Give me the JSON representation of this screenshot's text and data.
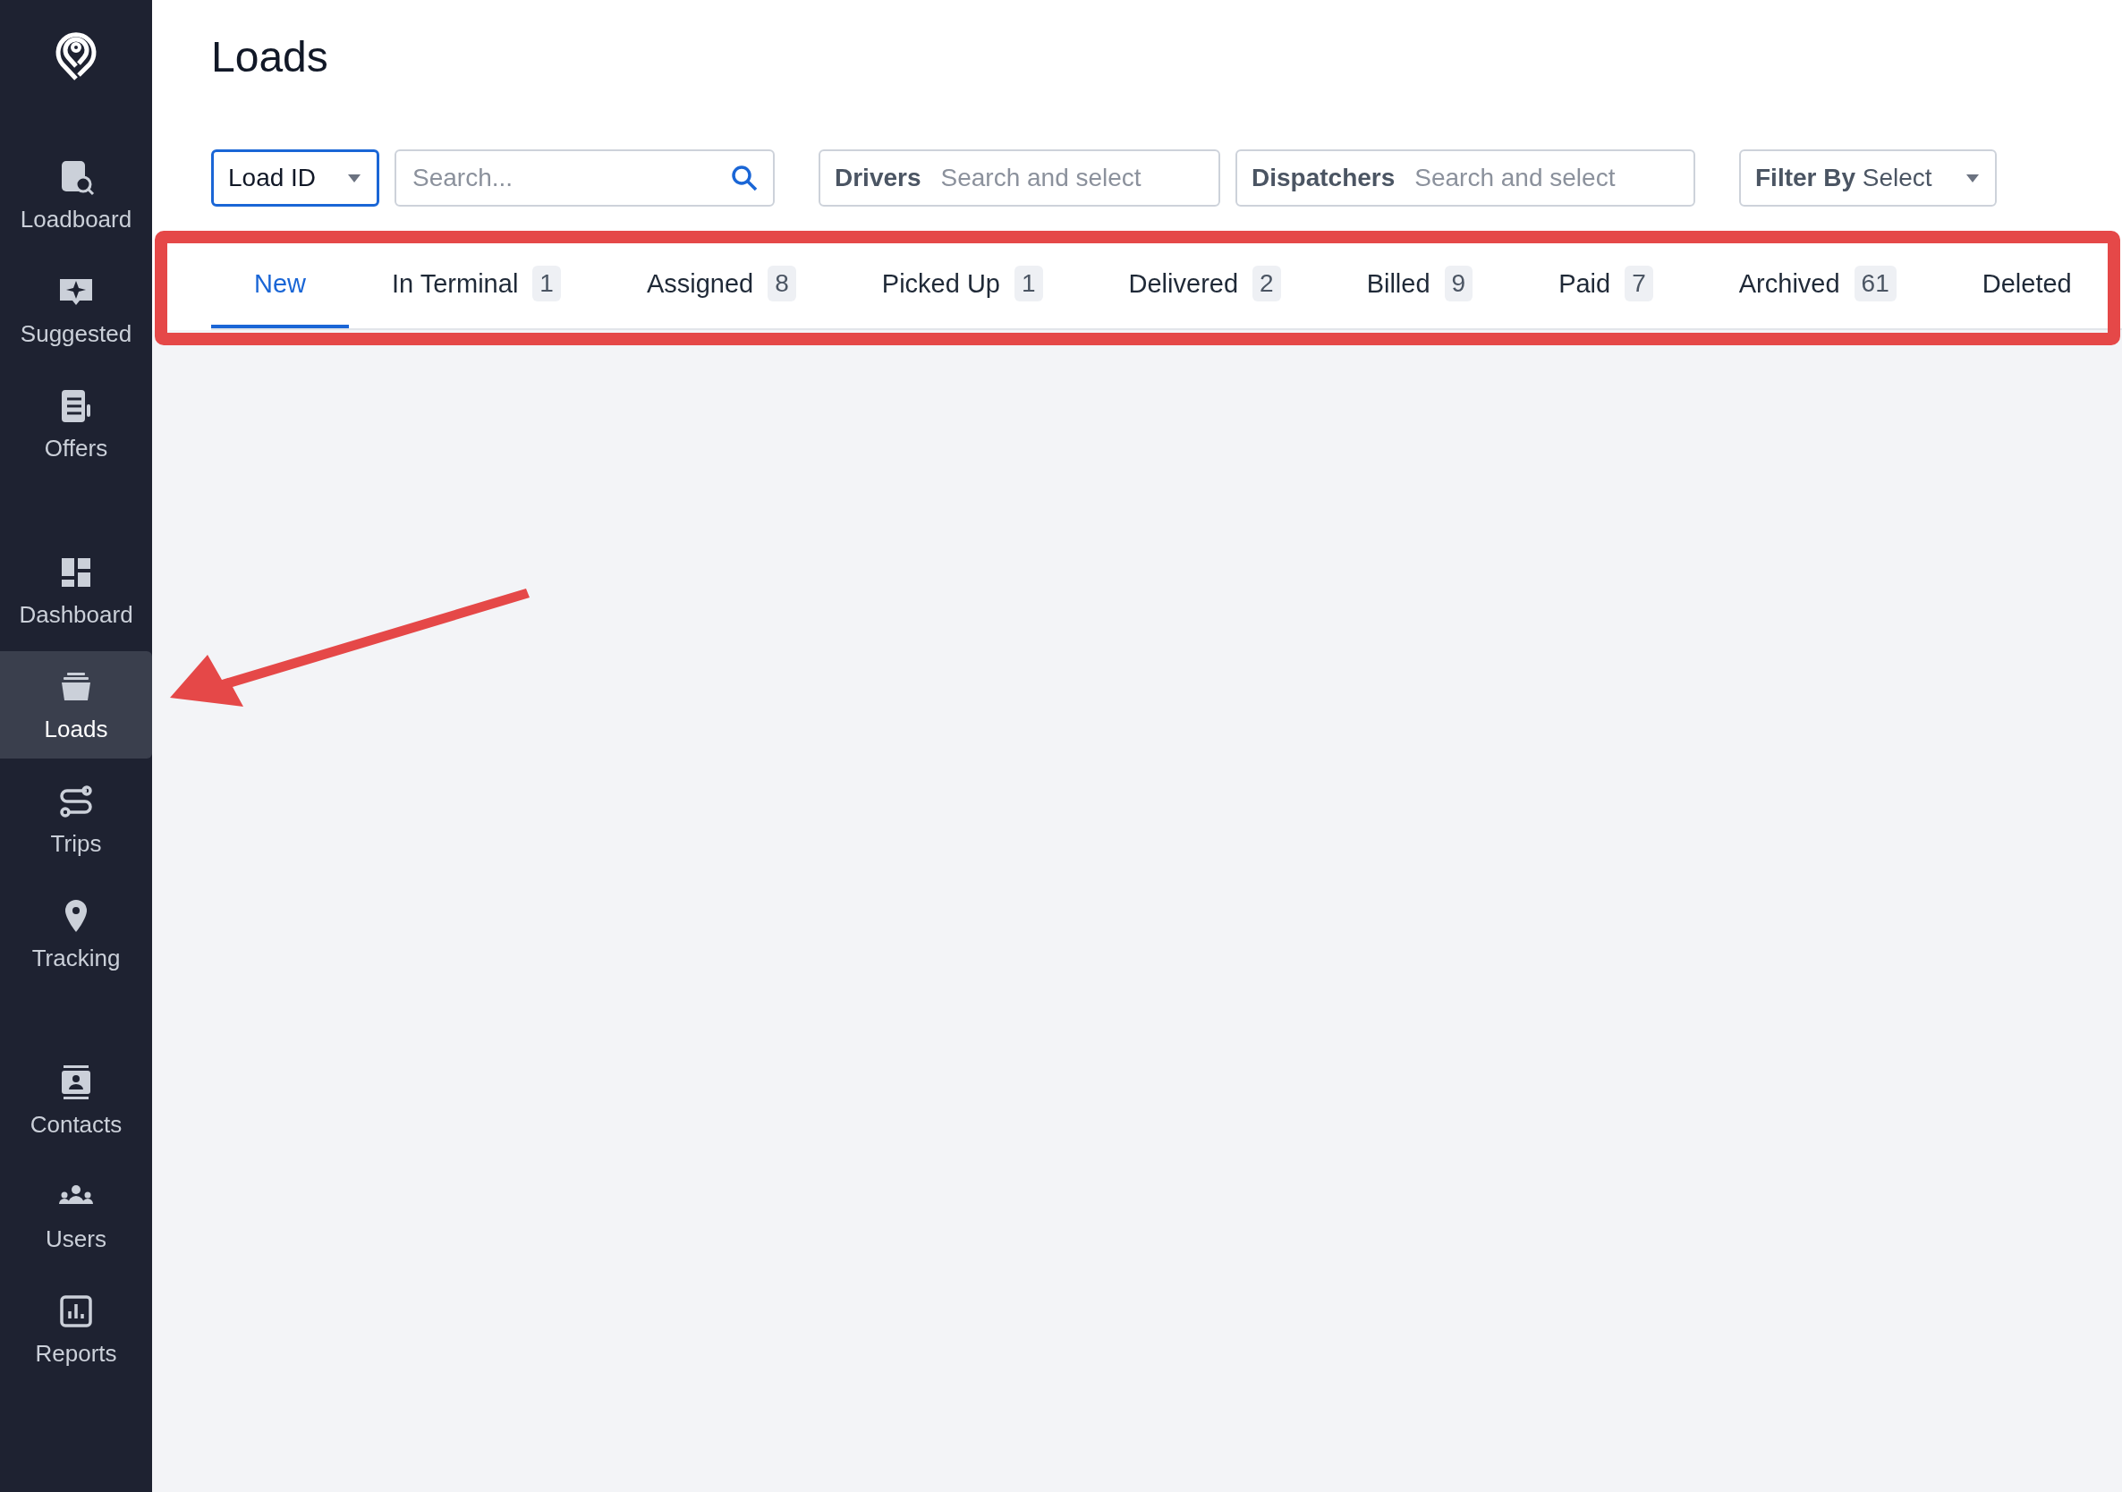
{
  "sidebar": {
    "groups": [
      [
        {
          "label": "Loadboard",
          "selected": false
        },
        {
          "label": "Suggested",
          "selected": false
        },
        {
          "label": "Offers",
          "selected": false
        }
      ],
      [
        {
          "label": "Dashboard",
          "selected": false
        },
        {
          "label": "Loads",
          "selected": true
        },
        {
          "label": "Trips",
          "selected": false
        },
        {
          "label": "Tracking",
          "selected": false
        }
      ],
      [
        {
          "label": "Contacts",
          "selected": false
        },
        {
          "label": "Users",
          "selected": false
        },
        {
          "label": "Reports",
          "selected": false
        }
      ]
    ]
  },
  "page": {
    "title": "Loads"
  },
  "filters": {
    "id_select": {
      "value": "Load ID",
      "focused": true
    },
    "search": {
      "placeholder": "Search..."
    },
    "drivers": {
      "label": "Drivers",
      "placeholder": "Search and select"
    },
    "dispatchers": {
      "label": "Dispatchers",
      "placeholder": "Search and select"
    },
    "filter_by": {
      "label": "Filter By",
      "value": "Select"
    }
  },
  "tabs": [
    {
      "label": "New",
      "selected": true
    },
    {
      "label": "In Terminal",
      "count": "1",
      "selected": false
    },
    {
      "label": "Assigned",
      "count": "8",
      "selected": false
    },
    {
      "label": "Picked Up",
      "count": "1",
      "selected": false
    },
    {
      "label": "Delivered",
      "count": "2",
      "selected": false
    },
    {
      "label": "Billed",
      "count": "9",
      "selected": false
    },
    {
      "label": "Paid",
      "count": "7",
      "selected": false
    },
    {
      "label": "Archived",
      "count": "61",
      "selected": false
    },
    {
      "label": "Deleted",
      "selected": false
    }
  ],
  "annotations": {
    "highlight": true,
    "arrow": true
  }
}
